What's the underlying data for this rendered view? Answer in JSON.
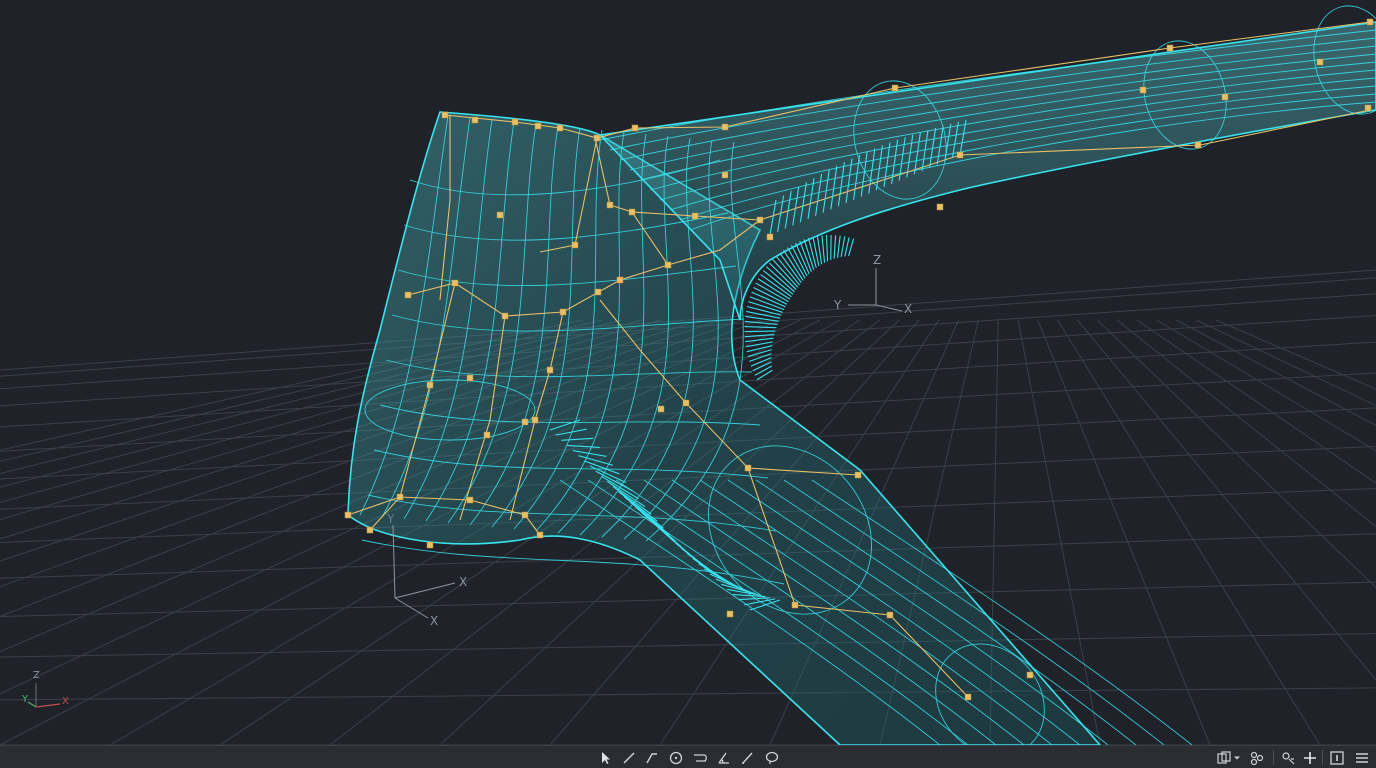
{
  "viewport": {
    "background": "#1f2329",
    "grid_color": "#3a4048",
    "surface_color": "#39e3ee",
    "control_net_color": "#e8c068",
    "world_axes": {
      "z": "Z",
      "x": "X",
      "y": "Y"
    },
    "gizmo_axes": {
      "z": "Z",
      "y": "Y",
      "x": "X"
    },
    "ground_axes": {
      "y": "Y",
      "x1": "X",
      "x2": "X"
    }
  },
  "statusbar": {
    "center_tools": [
      "select-cursor-icon",
      "line-tool-icon",
      "polyline-tool-icon",
      "circle-tool-icon",
      "curve-tool-icon",
      "measure-angle-icon",
      "pen-tool-icon",
      "lasso-tool-icon"
    ],
    "right_tools": [
      "layers-icon",
      "chevron-down-icon",
      "settings-nodes-icon",
      "snap-icon",
      "add-icon",
      "panel-icon",
      "menu-icon"
    ]
  }
}
